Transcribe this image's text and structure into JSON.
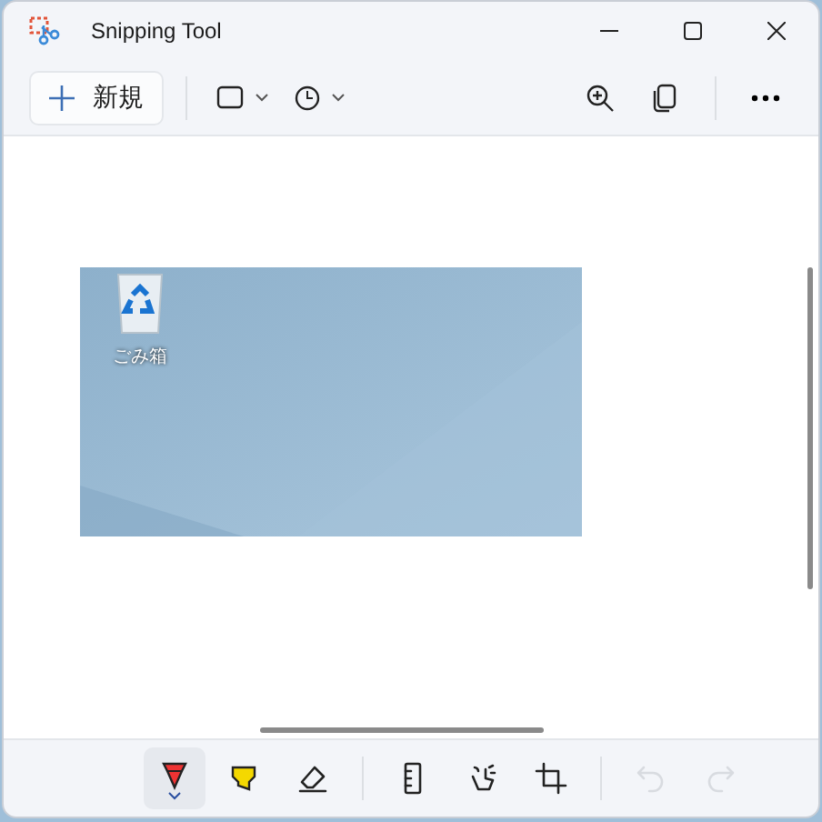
{
  "window": {
    "title": "Snipping Tool"
  },
  "toolbar": {
    "new_button": {
      "label": "新規"
    }
  },
  "capture": {
    "desktop_icons": [
      {
        "label": "ごみ箱"
      }
    ]
  },
  "tools": [
    {
      "kind": "pen",
      "selected": true,
      "disabled": false
    },
    {
      "kind": "highlighter",
      "selected": false,
      "disabled": false
    },
    {
      "kind": "eraser",
      "selected": false,
      "disabled": false
    },
    {
      "kind": "divider"
    },
    {
      "kind": "ruler",
      "selected": false,
      "disabled": false
    },
    {
      "kind": "touch",
      "selected": false,
      "disabled": false
    },
    {
      "kind": "crop",
      "selected": false,
      "disabled": false
    },
    {
      "kind": "divider"
    },
    {
      "kind": "undo",
      "selected": false,
      "disabled": true
    },
    {
      "kind": "redo",
      "selected": false,
      "disabled": true
    }
  ]
}
